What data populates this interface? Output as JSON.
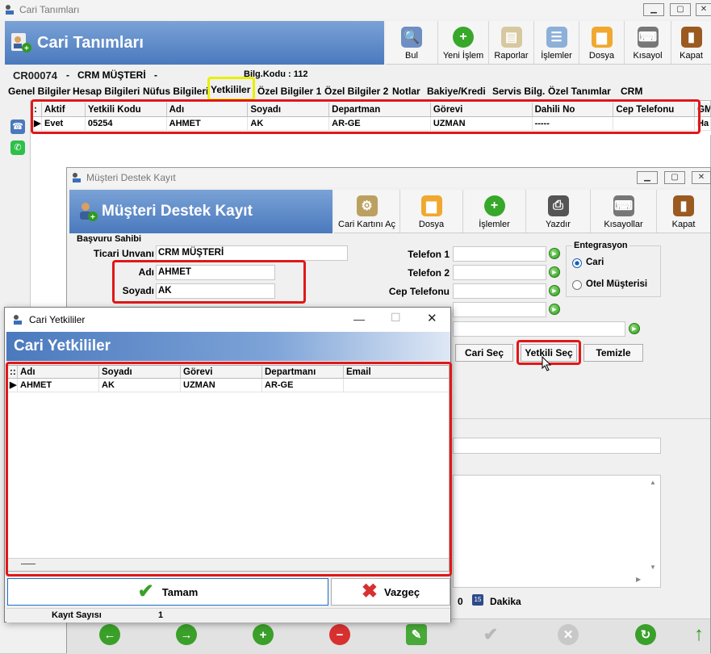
{
  "main": {
    "title": "Cari Tanımları",
    "banner_title": "Cari Tanımları",
    "toolbar": [
      "Bul",
      "Yeni İşlem",
      "Raporlar",
      "İşlemler",
      "Dosya",
      "Kısayol",
      "Kapat"
    ],
    "code": "CR00074",
    "dash1": "-",
    "customer": "CRM MÜŞTERİ",
    "dash2": "-",
    "bilg_kodu": "Bilg.Kodu : 112",
    "tabs": [
      "Genel Bilgiler",
      "Hesap Bilgileri",
      "Nüfus Bilgileri",
      "Yetkililer",
      "Özel Bilgiler 1",
      "Özel Bilgiler 2",
      "Notlar",
      "Bakiye/Kredi",
      "Servis Bilg.",
      "Özel Tanımlar",
      "CRM"
    ],
    "grid": {
      "headers": [
        "Aktif",
        "Yetkili Kodu",
        "Adı",
        "Soyadı",
        "Departman",
        "Görevi",
        "Dahili No",
        "Cep Telefonu",
        "GM"
      ],
      "row": [
        "Evet",
        "05254",
        "AHMET",
        "AK",
        "AR-GE",
        "UZMAN",
        "-----",
        "",
        "Ha"
      ]
    }
  },
  "destek": {
    "title": "Müşteri Destek Kayıt",
    "banner_title": "Müşteri Destek Kayıt",
    "toolbar": [
      "Cari Kartını Aç",
      "Dosya",
      "İşlemler",
      "Yazdır",
      "Kısayollar",
      "Kapat"
    ],
    "section": "Başvuru Sahibi",
    "ticari_label": "Ticari Unvanı",
    "ticari_value": "CRM MÜŞTERİ",
    "adi_label": "Adı",
    "adi_value": "AHMET",
    "soyadi_label": "Soyadı",
    "soyadi_value": "AK",
    "tel1_label": "Telefon 1",
    "tel2_label": "Telefon 2",
    "cep_label": "Cep Telefonu",
    "entegrasyon": "Entegrasyon",
    "radio_cari": "Cari",
    "radio_otel": "Otel Müşterisi",
    "btn_cari_sec": "Cari Seç",
    "btn_yetkili_sec": "Yetkili Seç",
    "btn_temizle": "Temizle",
    "duration_value": "0",
    "dakika": "Dakika"
  },
  "dialog": {
    "title": "Cari Yetkililer",
    "banner_title": "Cari Yetkililer",
    "grid": {
      "headers": [
        "Adı",
        "Soyadı",
        "Görevi",
        "Departmanı",
        "Email"
      ],
      "row": [
        "AHMET",
        "AK",
        "UZMAN",
        "AR-GE",
        ""
      ]
    },
    "ok": "Tamam",
    "cancel": "Vazgeç",
    "count_label": "Kayıt Sayısı",
    "count_value": "1"
  },
  "colors": {
    "highlight_red": "#e01818",
    "highlight_yellow": "#e8f000",
    "banner_blue": "#4a79bd"
  }
}
